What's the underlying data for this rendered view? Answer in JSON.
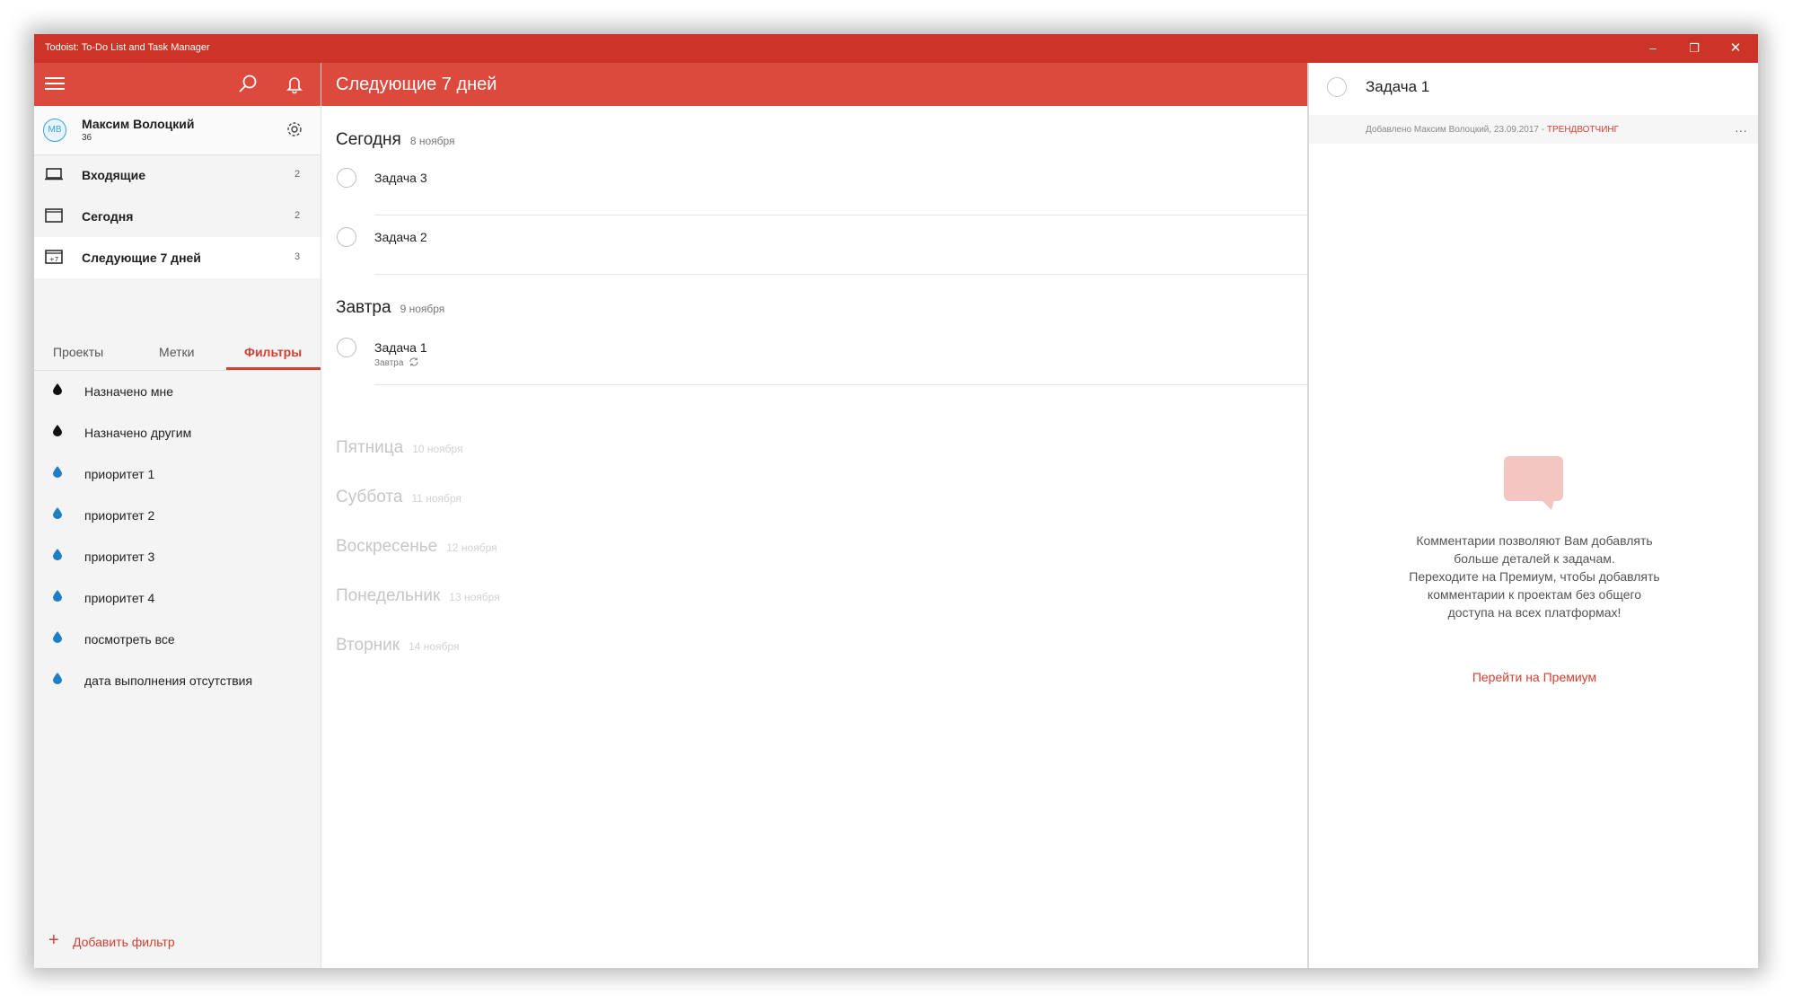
{
  "window": {
    "title": "Todoist: To-Do List and Task Manager",
    "controls": {
      "minimize": "–",
      "maximize": "❐",
      "close": "✕"
    }
  },
  "colors": {
    "accent": "#dc4a3e",
    "titlebar": "#cb3427",
    "link": "#d24133",
    "sidebar_bg": "#f4f4f4"
  },
  "user": {
    "initials": "MB",
    "name": "Максим Волоцкий",
    "karma": "36"
  },
  "nav": [
    {
      "icon": "inbox-icon",
      "label": "Входящие",
      "count": "2"
    },
    {
      "icon": "calendar-today-icon",
      "label": "Сегодня",
      "count": "2"
    },
    {
      "icon": "calendar-next7-icon",
      "label": "Следующие 7 дней",
      "count": "3",
      "badge": "+7"
    }
  ],
  "tabs": [
    {
      "label": "Проекты"
    },
    {
      "label": "Метки"
    },
    {
      "label": "Фильтры",
      "active": true
    }
  ],
  "filters": [
    {
      "label": "Назначено мне",
      "color": "#111111"
    },
    {
      "label": "Назначено другим",
      "color": "#111111"
    },
    {
      "label": "приоритет 1",
      "color": "#1f7fc5"
    },
    {
      "label": "приоритет 2",
      "color": "#1f7fc5"
    },
    {
      "label": "приоритет 3",
      "color": "#1f7fc5"
    },
    {
      "label": "приоритет 4",
      "color": "#1f7fc5"
    },
    {
      "label": "посмотреть все",
      "color": "#1f7fc5"
    },
    {
      "label": "дата выполнения отсутствия",
      "color": "#1f7fc5"
    }
  ],
  "add_filter": {
    "label": "Добавить фильтр"
  },
  "main": {
    "title": "Следующие 7 дней",
    "days": [
      {
        "name": "Сегодня",
        "date": "8 ноября",
        "tasks": [
          {
            "label": "Задача 3"
          },
          {
            "label": "Задача 2"
          }
        ]
      },
      {
        "name": "Завтра",
        "date": "9 ноября",
        "tasks": [
          {
            "label": "Задача 1",
            "sub": "Завтра"
          }
        ]
      },
      {
        "name": "Пятница",
        "date": "10 ноября"
      },
      {
        "name": "Суббота",
        "date": "11 ноября"
      },
      {
        "name": "Воскресенье",
        "date": "12 ноября"
      },
      {
        "name": "Понедельник",
        "date": "13 ноября"
      },
      {
        "name": "Вторник",
        "date": "14 ноября"
      }
    ]
  },
  "detail": {
    "task": "Задача 1",
    "meta": "Добавлено Максим Волоцкий, 23.09.2017 - ",
    "project": "ТРЕНДВОТЧИНГ",
    "menu": "···",
    "empty_lines": [
      "Комментарии позволяют Вам добавлять",
      "больше деталей к задачам.",
      "Переходите на Премиум, чтобы добавлять",
      "комментарии к проектам без общего",
      "доступа на всех платформах!"
    ],
    "premium_link": "Перейти на Премиум"
  }
}
